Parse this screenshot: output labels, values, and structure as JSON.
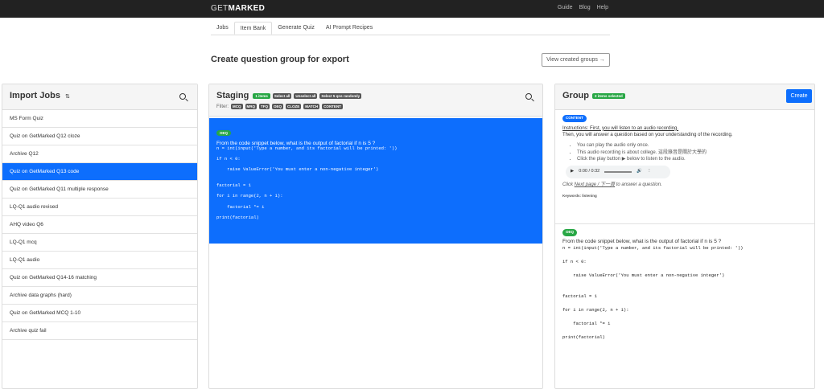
{
  "brand": {
    "part1": "GET",
    "part2": "MARKED"
  },
  "topnav": [
    "Guide",
    "Blog",
    "Help"
  ],
  "tabs": [
    {
      "label": "Jobs"
    },
    {
      "label": "Item Bank"
    },
    {
      "label": "Generate Quiz"
    },
    {
      "label": "AI Prompt Recipes"
    }
  ],
  "page_title": "Create question group for export",
  "view_groups_button": "View created groups →",
  "import_jobs": {
    "title": "Import Jobs",
    "sort_icon": "⇅",
    "items": [
      "MS Form Quiz",
      "Quiz on GetMarked Q12 cloze",
      "Archive Q12",
      "Quiz on GetMarked Q13 code",
      "Quiz on GetMarked Q11 multiple response",
      "LQ-Q1 audio revised",
      "AHQ video Q6",
      "LQ-Q1 mcq",
      "LQ-Q1 audio",
      "Quiz on GetMarked Q14-16 matching",
      "Archive data graphs (hard)",
      "Quiz on GetMarked MCQ 1-10",
      "Archive quiz fail"
    ],
    "active_index": 3
  },
  "staging": {
    "title": "Staging",
    "count_badge": "1 items",
    "select_all": "Select all",
    "unselect_all": "Unselect all",
    "select_random": "Select 5 qns randomly",
    "filter_label": "Filter:",
    "filters": [
      "MCQ",
      "MRQ",
      "TFQ",
      "OEQ",
      "CLOZE",
      "MATCH",
      "CONTENT"
    ]
  },
  "question": {
    "type": "OEQ",
    "text": "From the code snippet below, what is the output of factorial if n is 5 ?",
    "code": "n = int(input('Type a number, and its factorial will be printed: '))\n\nif n < 0:\n\n    raise ValueError('You must enter a non-negative integer')\n\n\nfactorial = 1\n\nfor i in range(2, n + 1):\n\n    factorial *= i\n\nprint(factorial)"
  },
  "group": {
    "title": "Group",
    "selected_badge": "2 items selected",
    "create_button": "Create",
    "content": {
      "type": "CONTENT",
      "instructions": "Instructions: First, you will listen to an audio recording.",
      "line2": "Then, you will answer a question based on your understanding of the recording.",
      "bullets": [
        "You can play the audio only once.",
        "This audio recording is about college. 這段錄音是關於大學的",
        "Click the play button ▶ below to listen to the audio."
      ],
      "audio_time": "0:00 / 0:32",
      "click_text_pre": "Click",
      "click_link": "Next page / 下一頁",
      "click_text_post": "to answer a question.",
      "keywords": "Keywords: listening"
    }
  }
}
